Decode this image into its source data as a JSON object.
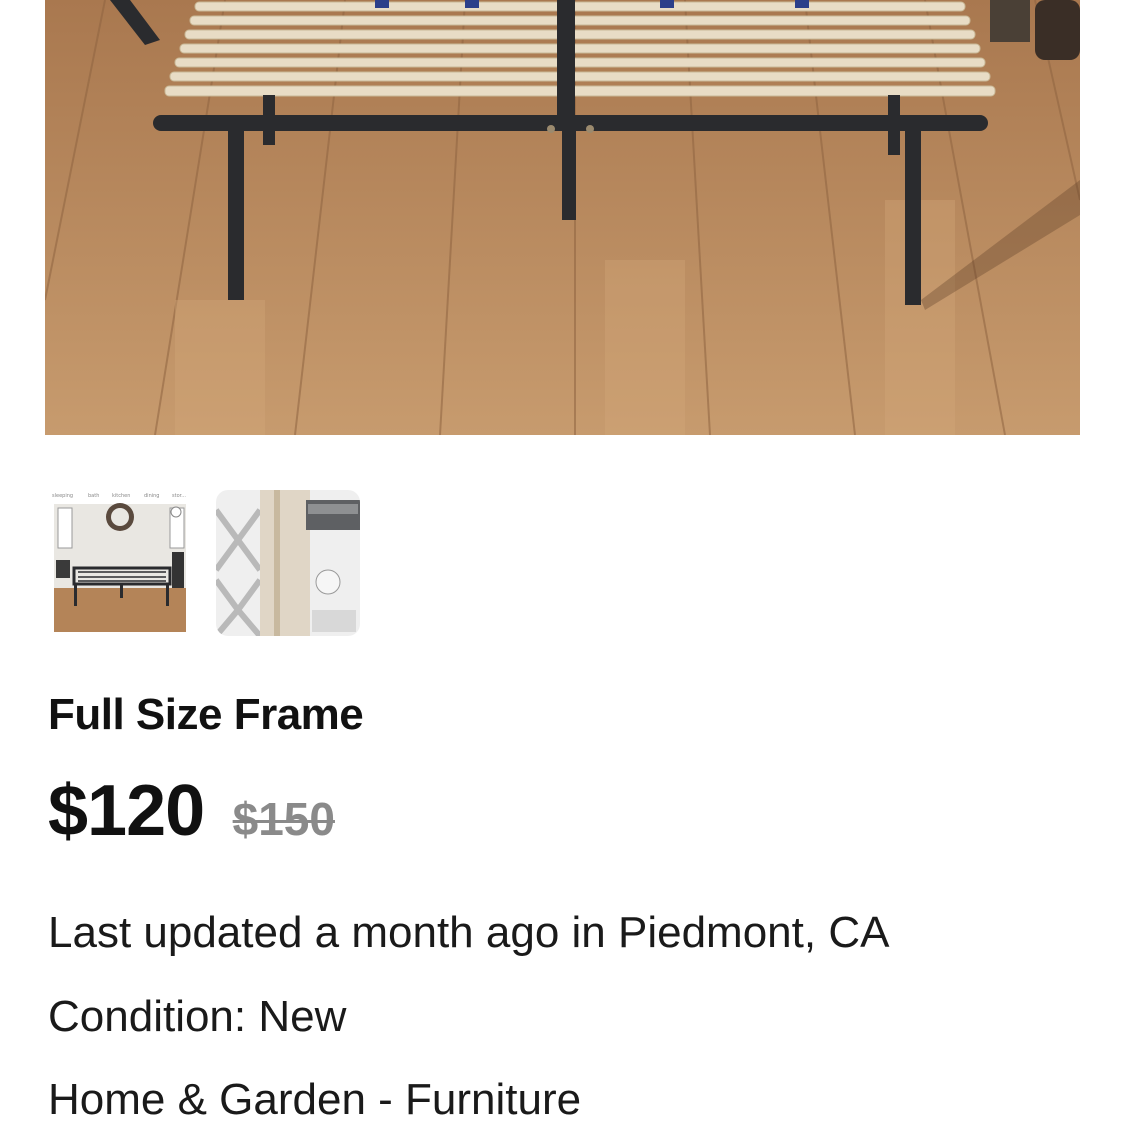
{
  "listing": {
    "title": "Full Size Frame",
    "price": "$120",
    "original_price": "$150",
    "last_updated": "Last updated a month ago in Piedmont, CA",
    "condition": "Condition: New",
    "category": "Home & Garden - Furniture"
  },
  "gallery": {
    "main_image": "bed-frame-photo",
    "thumbnails": [
      {
        "image": "bed-frame-room-thumbnail",
        "tabs": [
          "sleeping",
          "bath",
          "kitchen",
          "dining",
          "stor..."
        ]
      },
      {
        "image": "bed-frame-detail-thumbnail"
      }
    ]
  },
  "colors": {
    "text": "#111111",
    "strike_price": "#8a8a8a",
    "floor": "#b07f55",
    "frame_metal": "#2a2b2e",
    "slat_wood": "#e8dcc5"
  }
}
